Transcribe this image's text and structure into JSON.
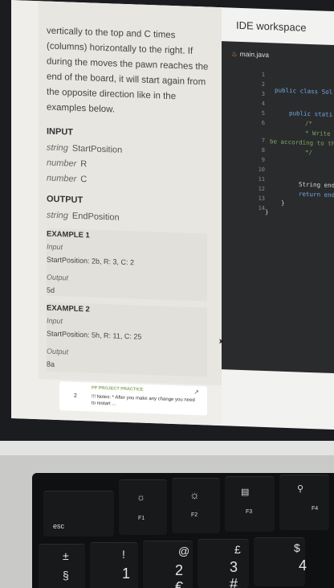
{
  "problem": {
    "paragraph": "vertically to the top and C times (columns) horizontally to the right. If during the moves the pawn reaches the end of the board, it will start again from the opposite direction like in the examples below.",
    "input_label": "INPUT",
    "inputs": [
      {
        "type": "string",
        "name": "StartPosition"
      },
      {
        "type": "number",
        "name": "R"
      },
      {
        "type": "number",
        "name": "C"
      }
    ],
    "output_label": "OUTPUT",
    "output": {
      "type": "string",
      "name": "EndPosition"
    },
    "examples": [
      {
        "title": "EXAMPLE 1",
        "input_label": "Input",
        "input": "StartPosition: 2b, R: 3, C: 2",
        "output_label": "Output",
        "output": "5d"
      },
      {
        "title": "EXAMPLE 2",
        "input_label": "Input",
        "input": "StartPosition: 5h, R: 11, C: 25",
        "output_label": "Output",
        "output": "8a"
      }
    ]
  },
  "notice": {
    "number": "2",
    "source": "PP PROJECT PRACTICE",
    "message": "!!! Notes: * After you make any change you need to restart ..."
  },
  "ide": {
    "title": "IDE workspace",
    "file_tab": "main.java",
    "line_numbers": [
      "1",
      "2",
      "3",
      "4",
      "5",
      "6",
      "7",
      "8",
      "9",
      "10",
      "11",
      "12",
      "13",
      "14"
    ],
    "code": {
      "line2": "public class Sol",
      "line4": "public stati",
      "line5": "/*",
      "line6": "* Write y",
      "line6b": "be according to th",
      "line7": "*/",
      "line10": "String endP",
      "line11": "return endP",
      "line12": "}",
      "line13": "}"
    }
  },
  "keyboard": {
    "esc": "esc",
    "f1": "F1",
    "f2": "F2",
    "f3": "F3",
    "f4": "F4",
    "row_numbers": [
      {
        "top": "±",
        "bottom": "§"
      },
      {
        "top": "!",
        "bottom": "1"
      },
      {
        "top": "@",
        "bottom": "2 €"
      },
      {
        "top": "£",
        "bottom": "3 #"
      },
      {
        "top": "$",
        "bottom": "4"
      }
    ]
  },
  "colors": {
    "editor_bg": "#2a2b2d",
    "keyword": "#6fa8dc",
    "comment": "#7aa35e",
    "file_icon": "#e3a14e"
  }
}
